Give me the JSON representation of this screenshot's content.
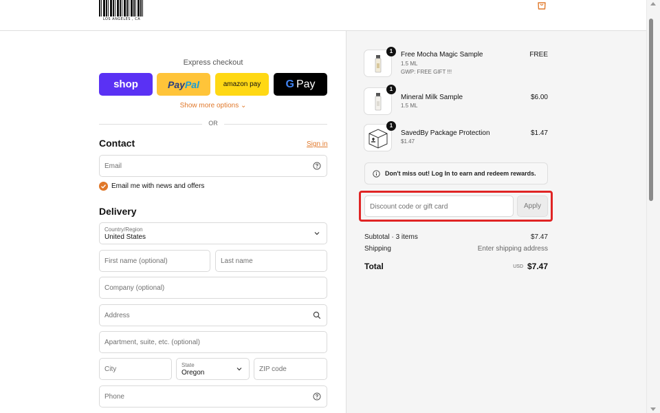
{
  "header": {
    "logo_text": "LOS ANGELES , CA",
    "cart_icon": "shopping-bag-icon"
  },
  "express": {
    "title": "Express checkout",
    "shop_label": "shop",
    "paypal_label_a": "Pay",
    "paypal_label_b": "Pal",
    "amazon_label": "amazon pay",
    "gpay_label": "Pay",
    "show_more": "Show more options ⌄",
    "or": "OR"
  },
  "contact": {
    "heading": "Contact",
    "signin": "Sign in",
    "email_placeholder": "Email",
    "newsletter_label": "Email me with news and offers"
  },
  "delivery": {
    "heading": "Delivery",
    "country_label": "Country/Region",
    "country_value": "United States",
    "first_name": "First name (optional)",
    "last_name": "Last name",
    "company": "Company (optional)",
    "address": "Address",
    "apartment": "Apartment, suite, etc. (optional)",
    "city": "City",
    "state_label": "State",
    "state_value": "Oregon",
    "zip": "ZIP code",
    "phone": "Phone"
  },
  "cart": {
    "items": [
      {
        "qty": "1",
        "name": "Free Mocha Magic Sample",
        "sub1": "1.5 ML",
        "sub2": "GWP: FREE GIFT !!!",
        "price": "FREE"
      },
      {
        "qty": "1",
        "name": "Mineral Milk Sample",
        "sub1": "1.5 ML",
        "sub2": "",
        "price": "$6.00"
      },
      {
        "qty": "1",
        "name": "SavedBy Package Protection",
        "sub1": "$1.47",
        "sub2": "",
        "price": "$1.47"
      }
    ],
    "rewards": "Don't miss out! Log In to earn and redeem rewards.",
    "discount_placeholder": "Discount code or gift card",
    "apply": "Apply",
    "subtotal_label": "Subtotal · 3 items",
    "subtotal_value": "$7.47",
    "shipping_label": "Shipping",
    "shipping_value": "Enter shipping address",
    "total_label": "Total",
    "currency": "USD",
    "total_value": "$7.47"
  },
  "colors": {
    "accent": "#e0782a",
    "shop": "#5a31f4",
    "paypal": "#ffc439",
    "amazon": "#ffd814",
    "highlight": "#e02424"
  }
}
